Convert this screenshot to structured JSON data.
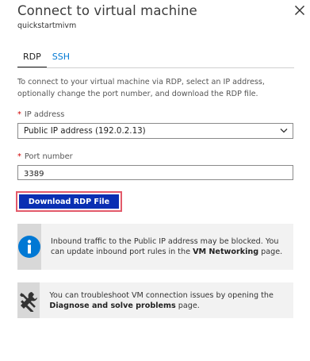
{
  "header": {
    "title": "Connect to virtual machine",
    "subtitle": "quickstartmivm"
  },
  "tabs": [
    {
      "label": "RDP",
      "active": true
    },
    {
      "label": "SSH",
      "active": false
    }
  ],
  "description": "To connect to your virtual machine via RDP, select an IP address, optionally change the port number, and download the RDP file.",
  "ip_address": {
    "label": "IP address",
    "value": "Public IP address (192.0.2.13)"
  },
  "port": {
    "label": "Port number",
    "value": "3389"
  },
  "download_button": {
    "label": "Download RDP File"
  },
  "info_notice": {
    "icon": "info-icon",
    "text_before": "Inbound traffic to the Public IP address may be blocked. You can update inbound port rules in the ",
    "link_text": "VM Networking",
    "text_after": " page."
  },
  "troubleshoot_notice": {
    "icon": "tools-icon",
    "text_before": "You can troubleshoot VM connection issues by opening the ",
    "link_text": "Diagnose and solve problems",
    "text_after": " page."
  },
  "colors": {
    "accent_blue": "#0078d4",
    "button_blue": "#0a2fb3",
    "highlight_red": "#e35a6a",
    "required_red": "#d00000"
  }
}
